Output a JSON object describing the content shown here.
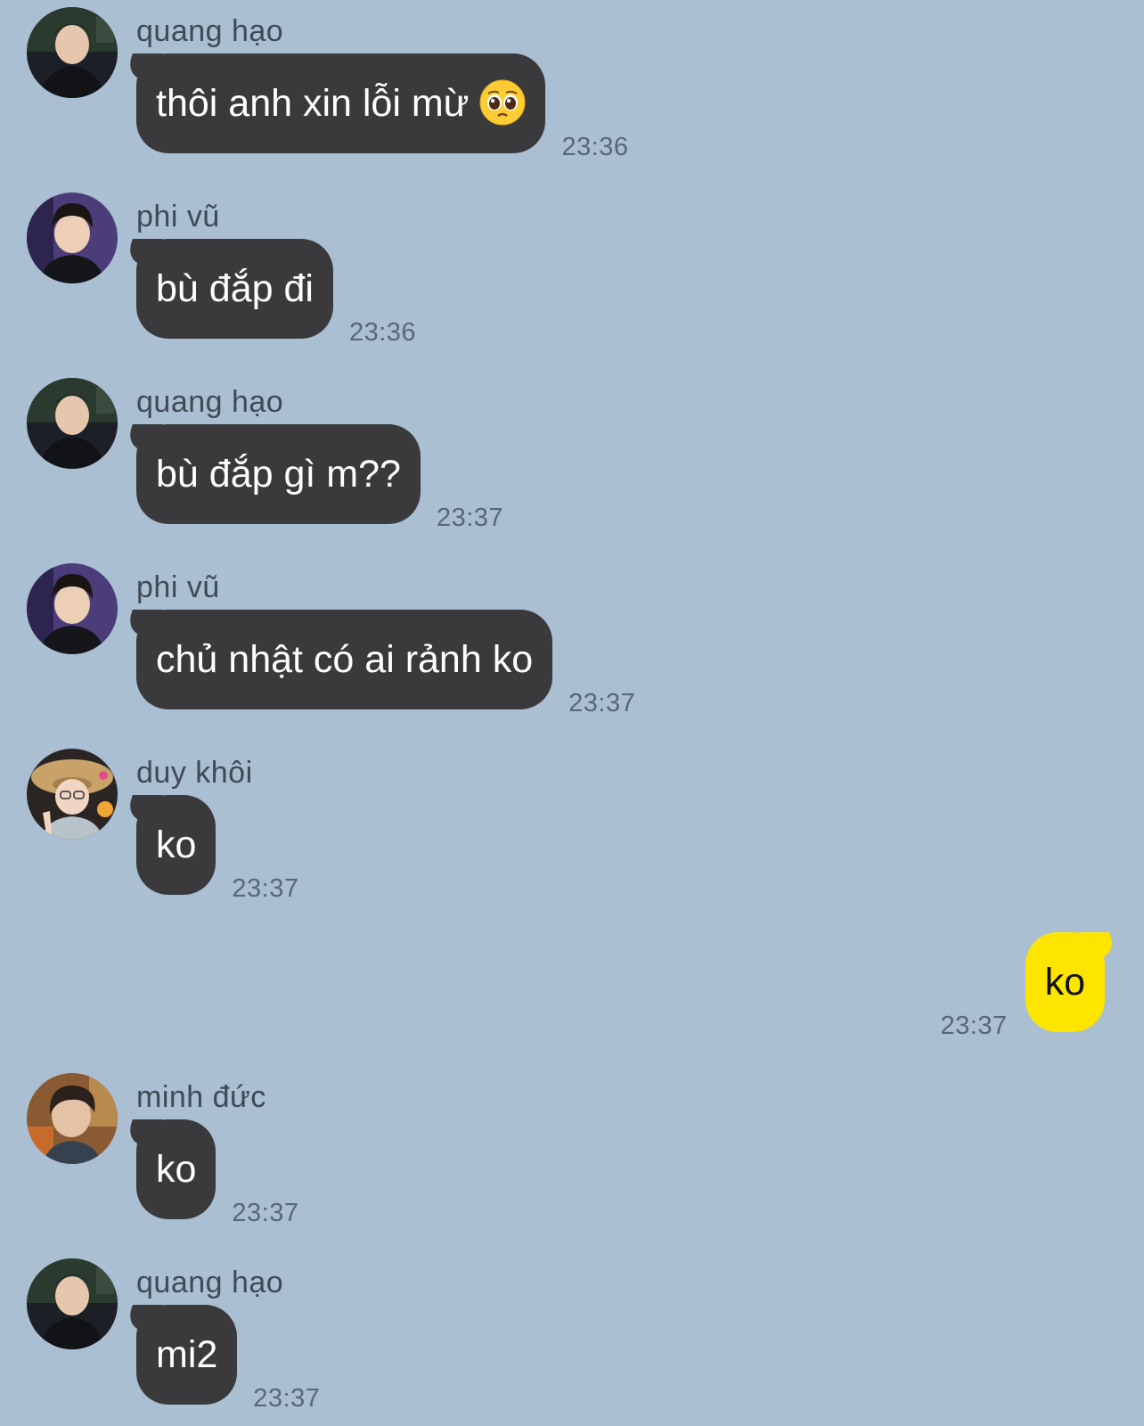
{
  "chat": {
    "messages": [
      {
        "sender": "quang hạo",
        "text": "thôi anh xin lỗi mừ",
        "time": "23:36",
        "emoji": "pleading-face-emoji"
      },
      {
        "sender": "phi vũ",
        "text": "bù đắp đi",
        "time": "23:36"
      },
      {
        "sender": "quang hạo",
        "text": "bù đắp gì m??",
        "time": "23:37"
      },
      {
        "sender": "phi vũ",
        "text": "chủ nhật có ai rảnh ko",
        "time": "23:37"
      },
      {
        "sender": "duy khôi",
        "text": "ko",
        "time": "23:37"
      },
      {
        "sender": "minh đức",
        "text": "ko",
        "time": "23:37"
      },
      {
        "sender": "quang hạo",
        "text": "mi2",
        "time": "23:37"
      }
    ],
    "own_message": {
      "text": "ko",
      "time": "23:37"
    }
  },
  "colors": {
    "background": "#aabfd2",
    "incoming_bubble": "#3a3a3c",
    "outgoing_bubble": "#fee500",
    "timestamp": "#5a6774"
  },
  "icons": {
    "avatar_quang_hao": "avatar-photo",
    "avatar_phi_vu": "avatar-photo",
    "avatar_duy_khoi": "avatar-photo",
    "avatar_minh_duc": "avatar-photo"
  }
}
